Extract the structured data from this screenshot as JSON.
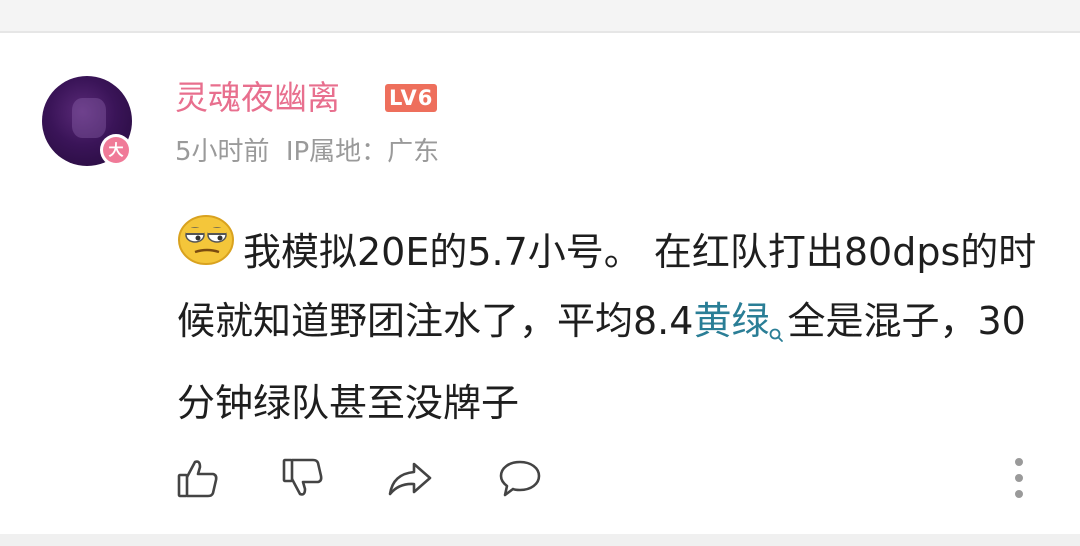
{
  "comment": {
    "username": "灵魂夜幽离",
    "level_badge": "LV6",
    "avatar_badge": "大",
    "time": "5小时前",
    "ip_location": "IP属地：广东",
    "emoji_icon": "smug-face-emoji",
    "text_part1": "我模拟20E的5.7小号。 在红队打出80dps的时候就知道野团注水了，平均8.4",
    "link_word": "黄绿",
    "text_part2": "全是混子，30分钟绿队甚至没牌子"
  },
  "actions": {
    "like_icon": "thumbs-up-icon",
    "dislike_icon": "thumbs-down-icon",
    "share_icon": "share-icon",
    "reply_icon": "comment-icon",
    "more_icon": "more-vertical-icon"
  },
  "colors": {
    "username": "#e86f8e",
    "level_badge": "#ee6f5c",
    "link_word": "#2a7e96",
    "meta_text": "#9a9a9a"
  }
}
